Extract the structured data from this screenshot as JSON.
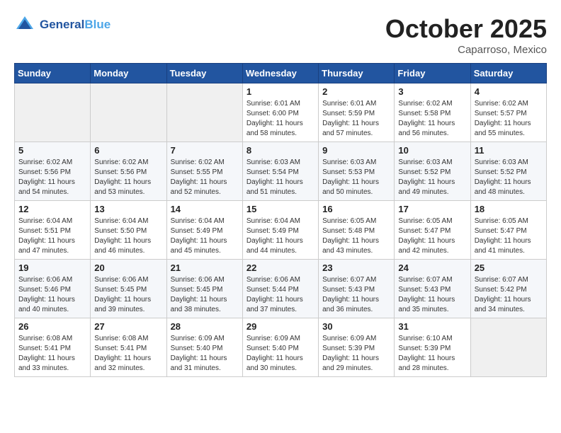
{
  "header": {
    "logo_line1": "General",
    "logo_line2": "Blue",
    "month": "October 2025",
    "location": "Caparroso, Mexico"
  },
  "weekdays": [
    "Sunday",
    "Monday",
    "Tuesday",
    "Wednesday",
    "Thursday",
    "Friday",
    "Saturday"
  ],
  "weeks": [
    [
      {
        "day": "",
        "info": ""
      },
      {
        "day": "",
        "info": ""
      },
      {
        "day": "",
        "info": ""
      },
      {
        "day": "1",
        "info": "Sunrise: 6:01 AM\nSunset: 6:00 PM\nDaylight: 11 hours\nand 58 minutes."
      },
      {
        "day": "2",
        "info": "Sunrise: 6:01 AM\nSunset: 5:59 PM\nDaylight: 11 hours\nand 57 minutes."
      },
      {
        "day": "3",
        "info": "Sunrise: 6:02 AM\nSunset: 5:58 PM\nDaylight: 11 hours\nand 56 minutes."
      },
      {
        "day": "4",
        "info": "Sunrise: 6:02 AM\nSunset: 5:57 PM\nDaylight: 11 hours\nand 55 minutes."
      }
    ],
    [
      {
        "day": "5",
        "info": "Sunrise: 6:02 AM\nSunset: 5:56 PM\nDaylight: 11 hours\nand 54 minutes."
      },
      {
        "day": "6",
        "info": "Sunrise: 6:02 AM\nSunset: 5:56 PM\nDaylight: 11 hours\nand 53 minutes."
      },
      {
        "day": "7",
        "info": "Sunrise: 6:02 AM\nSunset: 5:55 PM\nDaylight: 11 hours\nand 52 minutes."
      },
      {
        "day": "8",
        "info": "Sunrise: 6:03 AM\nSunset: 5:54 PM\nDaylight: 11 hours\nand 51 minutes."
      },
      {
        "day": "9",
        "info": "Sunrise: 6:03 AM\nSunset: 5:53 PM\nDaylight: 11 hours\nand 50 minutes."
      },
      {
        "day": "10",
        "info": "Sunrise: 6:03 AM\nSunset: 5:52 PM\nDaylight: 11 hours\nand 49 minutes."
      },
      {
        "day": "11",
        "info": "Sunrise: 6:03 AM\nSunset: 5:52 PM\nDaylight: 11 hours\nand 48 minutes."
      }
    ],
    [
      {
        "day": "12",
        "info": "Sunrise: 6:04 AM\nSunset: 5:51 PM\nDaylight: 11 hours\nand 47 minutes."
      },
      {
        "day": "13",
        "info": "Sunrise: 6:04 AM\nSunset: 5:50 PM\nDaylight: 11 hours\nand 46 minutes."
      },
      {
        "day": "14",
        "info": "Sunrise: 6:04 AM\nSunset: 5:49 PM\nDaylight: 11 hours\nand 45 minutes."
      },
      {
        "day": "15",
        "info": "Sunrise: 6:04 AM\nSunset: 5:49 PM\nDaylight: 11 hours\nand 44 minutes."
      },
      {
        "day": "16",
        "info": "Sunrise: 6:05 AM\nSunset: 5:48 PM\nDaylight: 11 hours\nand 43 minutes."
      },
      {
        "day": "17",
        "info": "Sunrise: 6:05 AM\nSunset: 5:47 PM\nDaylight: 11 hours\nand 42 minutes."
      },
      {
        "day": "18",
        "info": "Sunrise: 6:05 AM\nSunset: 5:47 PM\nDaylight: 11 hours\nand 41 minutes."
      }
    ],
    [
      {
        "day": "19",
        "info": "Sunrise: 6:06 AM\nSunset: 5:46 PM\nDaylight: 11 hours\nand 40 minutes."
      },
      {
        "day": "20",
        "info": "Sunrise: 6:06 AM\nSunset: 5:45 PM\nDaylight: 11 hours\nand 39 minutes."
      },
      {
        "day": "21",
        "info": "Sunrise: 6:06 AM\nSunset: 5:45 PM\nDaylight: 11 hours\nand 38 minutes."
      },
      {
        "day": "22",
        "info": "Sunrise: 6:06 AM\nSunset: 5:44 PM\nDaylight: 11 hours\nand 37 minutes."
      },
      {
        "day": "23",
        "info": "Sunrise: 6:07 AM\nSunset: 5:43 PM\nDaylight: 11 hours\nand 36 minutes."
      },
      {
        "day": "24",
        "info": "Sunrise: 6:07 AM\nSunset: 5:43 PM\nDaylight: 11 hours\nand 35 minutes."
      },
      {
        "day": "25",
        "info": "Sunrise: 6:07 AM\nSunset: 5:42 PM\nDaylight: 11 hours\nand 34 minutes."
      }
    ],
    [
      {
        "day": "26",
        "info": "Sunrise: 6:08 AM\nSunset: 5:41 PM\nDaylight: 11 hours\nand 33 minutes."
      },
      {
        "day": "27",
        "info": "Sunrise: 6:08 AM\nSunset: 5:41 PM\nDaylight: 11 hours\nand 32 minutes."
      },
      {
        "day": "28",
        "info": "Sunrise: 6:09 AM\nSunset: 5:40 PM\nDaylight: 11 hours\nand 31 minutes."
      },
      {
        "day": "29",
        "info": "Sunrise: 6:09 AM\nSunset: 5:40 PM\nDaylight: 11 hours\nand 30 minutes."
      },
      {
        "day": "30",
        "info": "Sunrise: 6:09 AM\nSunset: 5:39 PM\nDaylight: 11 hours\nand 29 minutes."
      },
      {
        "day": "31",
        "info": "Sunrise: 6:10 AM\nSunset: 5:39 PM\nDaylight: 11 hours\nand 28 minutes."
      },
      {
        "day": "",
        "info": ""
      }
    ]
  ]
}
